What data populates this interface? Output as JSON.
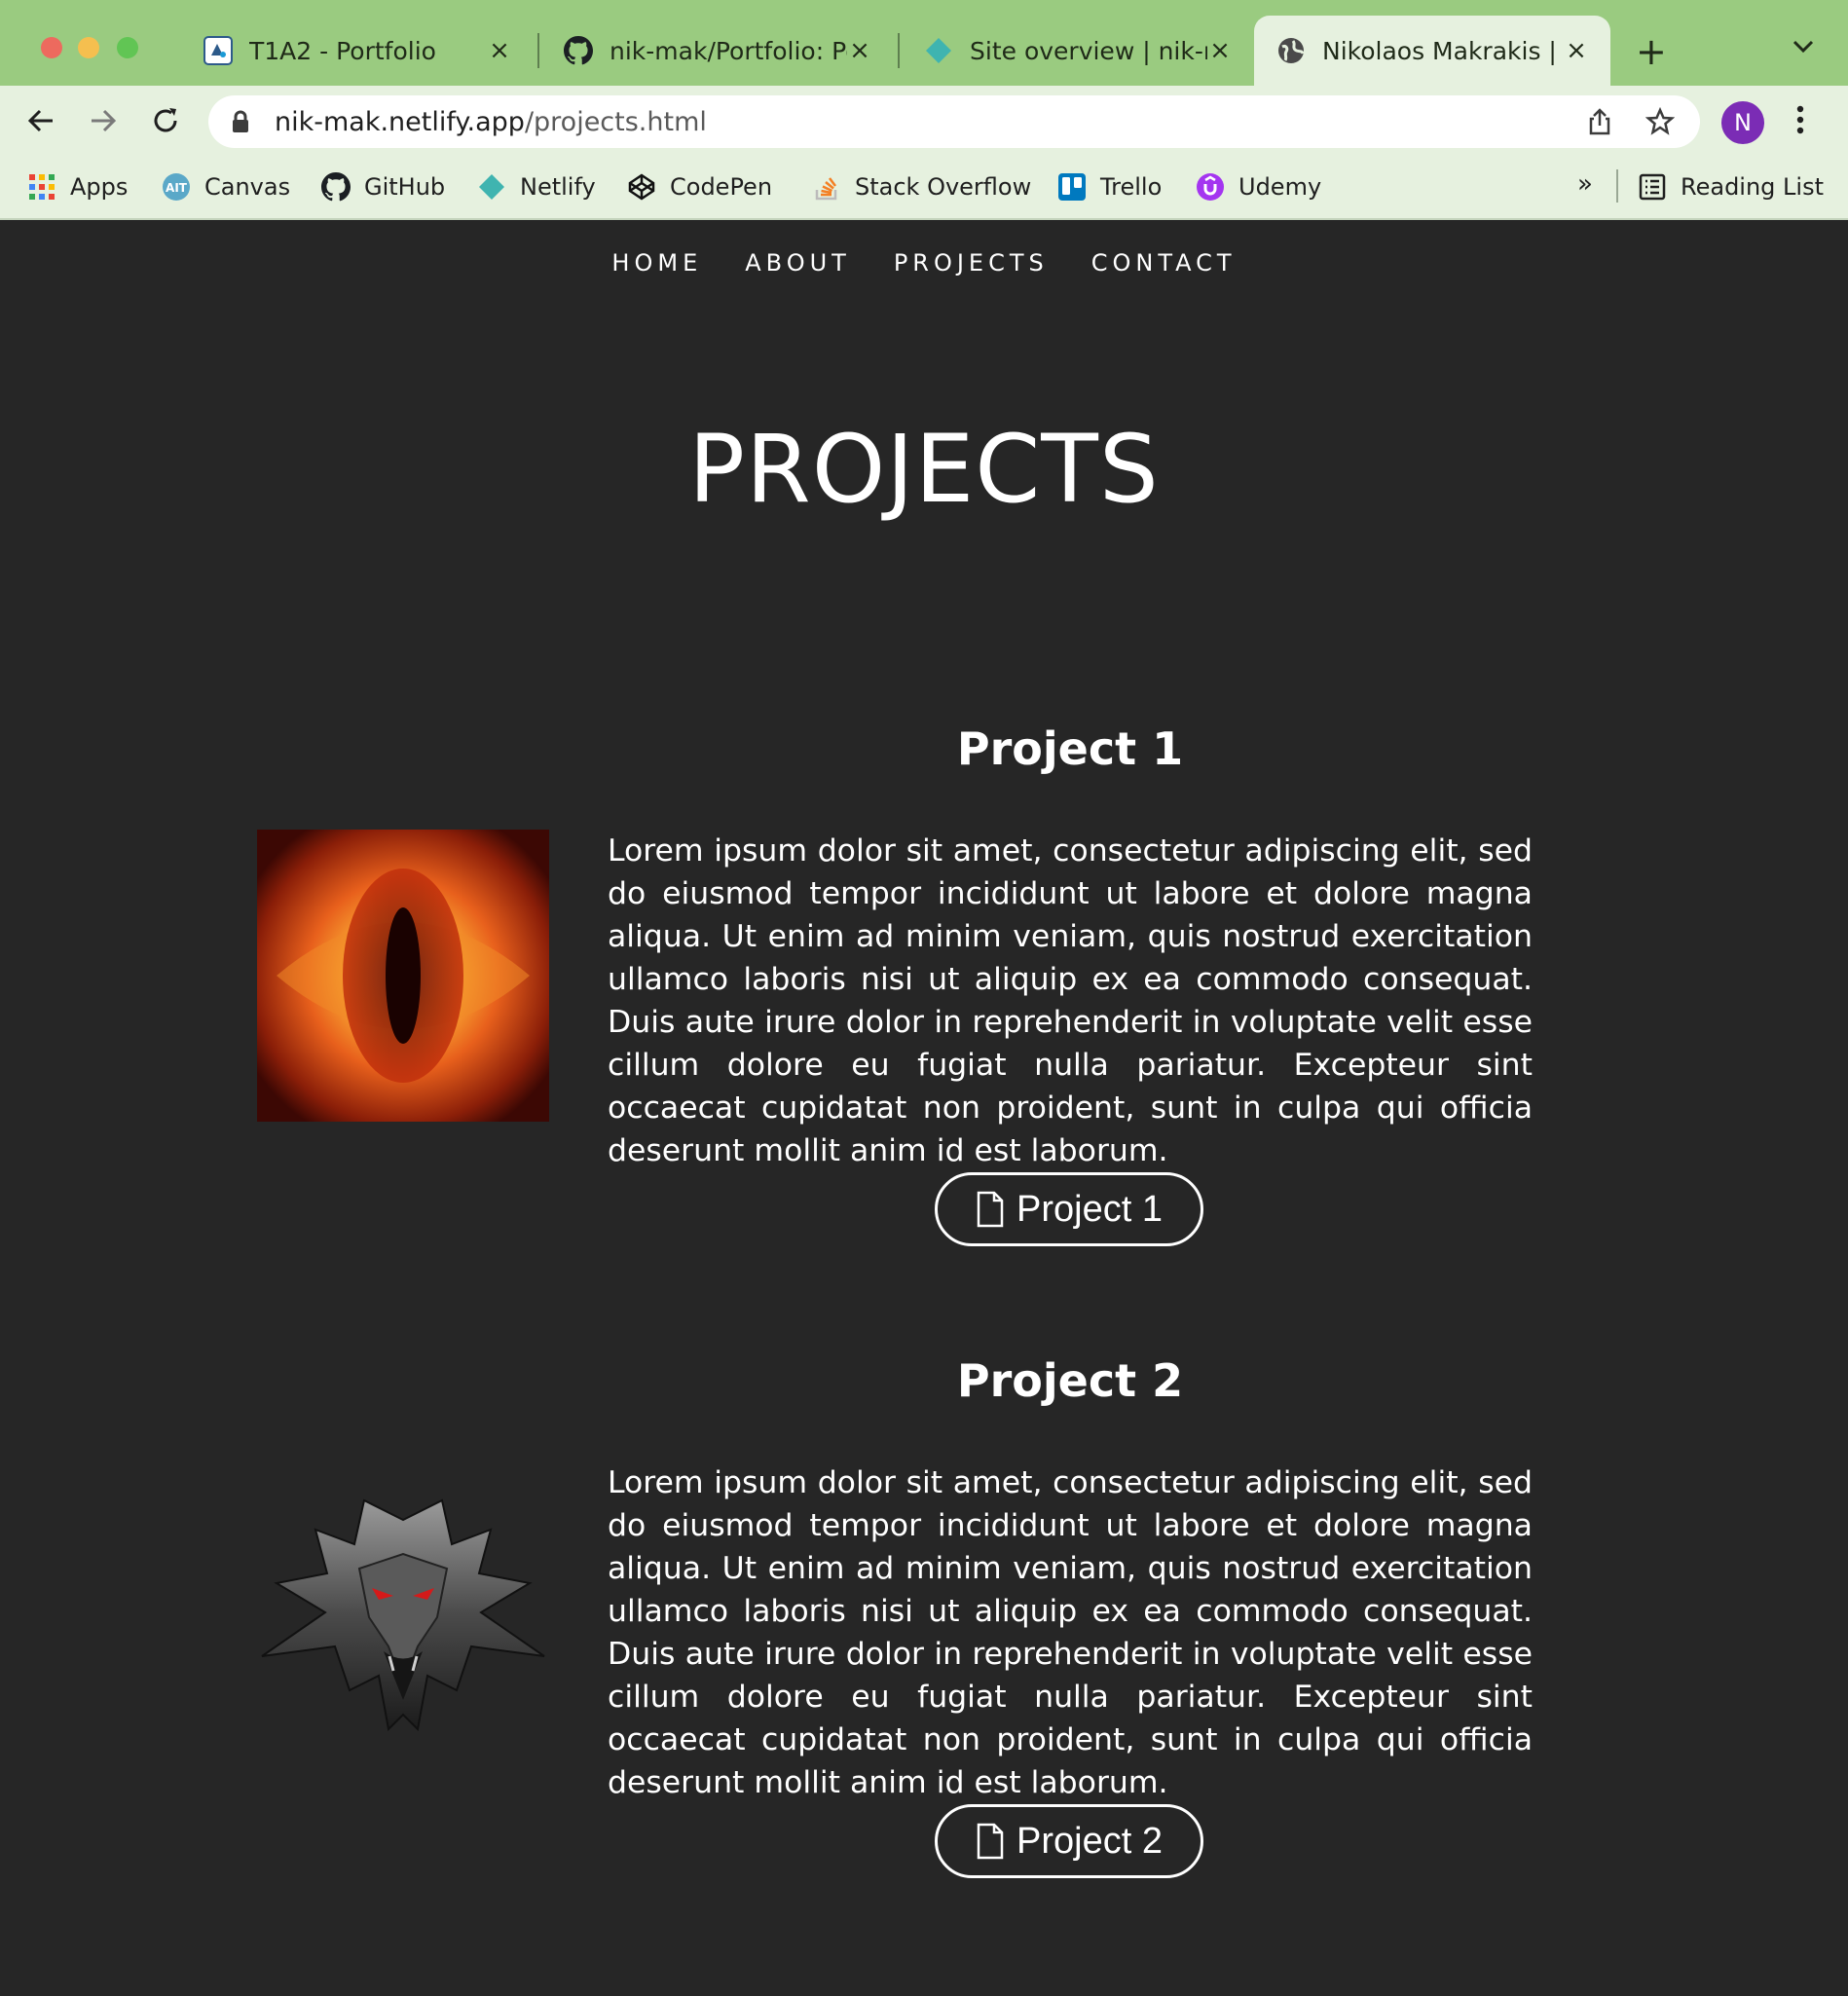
{
  "browser": {
    "tabs": [
      {
        "title": "T1A2 - Portfolio",
        "icon": "canvas-favicon"
      },
      {
        "title": "nik-mak/Portfolio: Po",
        "icon": "github-favicon"
      },
      {
        "title": "Site overview | nik-m",
        "icon": "netlify-favicon"
      },
      {
        "title": "Nikolaos Makrakis | P",
        "icon": "globe-favicon",
        "active": true
      }
    ],
    "url_host": "nik-mak.netlify.app",
    "url_path": "/projects.html",
    "profile_initial": "N",
    "bookmarks": [
      {
        "label": "Apps",
        "icon": "apps-grid-icon"
      },
      {
        "label": "Canvas",
        "icon": "canvas-icon"
      },
      {
        "label": "GitHub",
        "icon": "github-icon"
      },
      {
        "label": "Netlify",
        "icon": "netlify-icon"
      },
      {
        "label": "CodePen",
        "icon": "codepen-icon"
      },
      {
        "label": "Stack Overflow",
        "icon": "stackoverflow-icon"
      },
      {
        "label": "Trello",
        "icon": "trello-icon"
      },
      {
        "label": "Udemy",
        "icon": "udemy-icon"
      }
    ],
    "bookmarks_overflow": "»",
    "reading_list": "Reading List"
  },
  "nav": {
    "items": [
      "HOME",
      "ABOUT",
      "PROJECTS",
      "CONTACT"
    ]
  },
  "page_title": "PROJECTS",
  "projects": [
    {
      "title": "Project 1",
      "image": "eye-of-sauron",
      "text": "Lorem ipsum dolor sit amet, consectetur adipiscing elit, sed do eiusmod tempor incididunt ut labore et dolore magna aliqua. Ut enim ad minim veniam, quis nostrud exercitation ullamco laboris nisi ut aliquip ex ea commodo consequat. Duis aute irure dolor in reprehenderit in voluptate velit esse cillum dolore eu fugiat nulla pariatur. Excepteur sint occaecat cupidatat non proident, sunt in culpa qui officia deserunt mollit anim id est laborum.",
      "button": "Project 1"
    },
    {
      "title": "Project 2",
      "image": "witcher-wolf-medallion",
      "text": "Lorem ipsum dolor sit amet, consectetur adipiscing elit, sed do eiusmod tempor incididunt ut labore et dolore magna aliqua. Ut enim ad minim veniam, quis nostrud exercitation ullamco laboris nisi ut aliquip ex ea commodo consequat. Duis aute irure dolor in reprehenderit in voluptate velit esse cillum dolore eu fugiat nulla pariatur. Excepteur sint occaecat cupidatat non proident, sunt in culpa qui officia deserunt mollit anim id est laborum.",
      "button": "Project 2"
    }
  ],
  "colors": {
    "tab_strip": "#9acb80",
    "toolbar": "#e6f1df",
    "page_bg": "#262626",
    "text": "#ffffff",
    "avatar": "#7b2cb5"
  }
}
